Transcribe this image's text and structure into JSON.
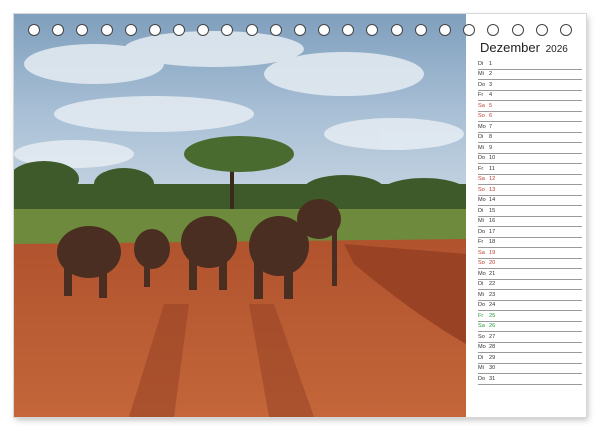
{
  "calendar": {
    "month": "Dezember",
    "year": "2026",
    "days": [
      {
        "wd": "Di",
        "d": "1",
        "type": "weekday"
      },
      {
        "wd": "Mi",
        "d": "2",
        "type": "weekday"
      },
      {
        "wd": "Do",
        "d": "3",
        "type": "weekday"
      },
      {
        "wd": "Fr",
        "d": "4",
        "type": "weekday"
      },
      {
        "wd": "Sa",
        "d": "5",
        "type": "weekend"
      },
      {
        "wd": "So",
        "d": "6",
        "type": "weekend"
      },
      {
        "wd": "Mo",
        "d": "7",
        "type": "weekday"
      },
      {
        "wd": "Di",
        "d": "8",
        "type": "weekday"
      },
      {
        "wd": "Mi",
        "d": "9",
        "type": "weekday"
      },
      {
        "wd": "Do",
        "d": "10",
        "type": "weekday"
      },
      {
        "wd": "Fr",
        "d": "11",
        "type": "weekday"
      },
      {
        "wd": "Sa",
        "d": "12",
        "type": "weekend"
      },
      {
        "wd": "So",
        "d": "13",
        "type": "weekend"
      },
      {
        "wd": "Mo",
        "d": "14",
        "type": "weekday"
      },
      {
        "wd": "Di",
        "d": "15",
        "type": "weekday"
      },
      {
        "wd": "Mi",
        "d": "16",
        "type": "weekday"
      },
      {
        "wd": "Do",
        "d": "17",
        "type": "weekday"
      },
      {
        "wd": "Fr",
        "d": "18",
        "type": "weekday"
      },
      {
        "wd": "Sa",
        "d": "19",
        "type": "weekend"
      },
      {
        "wd": "So",
        "d": "20",
        "type": "weekend"
      },
      {
        "wd": "Mo",
        "d": "21",
        "type": "weekday"
      },
      {
        "wd": "Di",
        "d": "22",
        "type": "weekday"
      },
      {
        "wd": "Mi",
        "d": "23",
        "type": "weekday"
      },
      {
        "wd": "Do",
        "d": "24",
        "type": "weekday"
      },
      {
        "wd": "Fr",
        "d": "25",
        "type": "holiday"
      },
      {
        "wd": "Sa",
        "d": "26",
        "type": "holiday"
      },
      {
        "wd": "So",
        "d": "27",
        "type": "weekday"
      },
      {
        "wd": "Mo",
        "d": "28",
        "type": "weekday"
      },
      {
        "wd": "Di",
        "d": "29",
        "type": "weekday"
      },
      {
        "wd": "Mi",
        "d": "30",
        "type": "weekday"
      },
      {
        "wd": "Do",
        "d": "31",
        "type": "weekday"
      }
    ]
  },
  "colors": {
    "weekend": "#c0392b",
    "holiday": "#2a9a3a",
    "road": "#b8552a",
    "sky": "#9fb8cf"
  }
}
